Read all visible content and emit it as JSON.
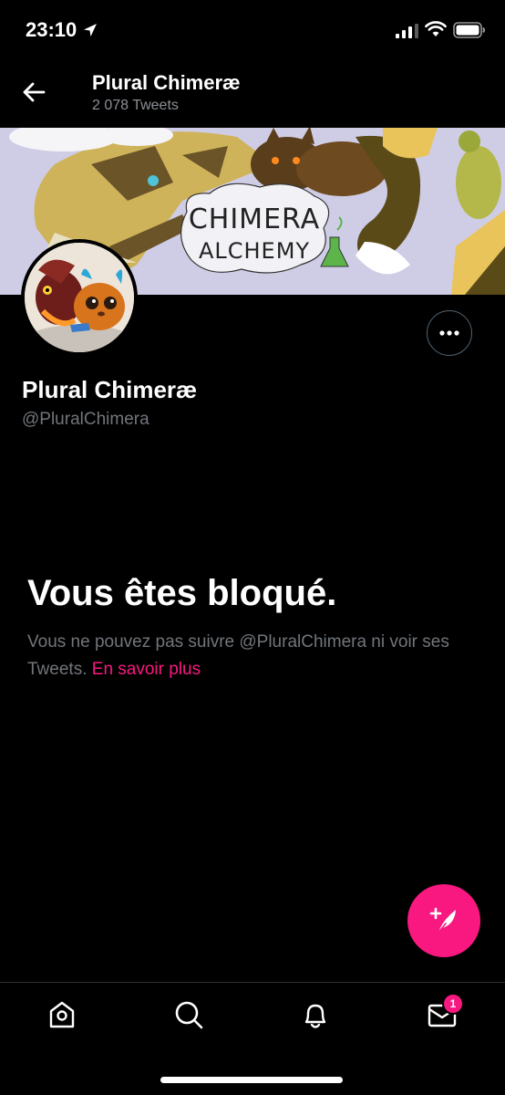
{
  "status_bar": {
    "time": "23:10",
    "icons": [
      "location-arrow-icon",
      "signal-icon",
      "wifi-icon",
      "battery-icon"
    ]
  },
  "header": {
    "back_icon": "arrow-left-icon",
    "title": "Plural Chimeræ",
    "subtitle": "2 078 Tweets"
  },
  "banner": {
    "text_line1": "CHIMERA",
    "text_line2": "ALCHEMY",
    "background_color": "#cfcde6"
  },
  "profile": {
    "name": "Plural Chimeræ",
    "handle": "@PluralChimera",
    "more_icon": "more-horizontal-icon"
  },
  "blocked": {
    "title": "Vous êtes bloqué.",
    "description": "Vous ne pouvez pas suivre @PluralChimera ni voir ses Tweets.",
    "learn_more": "En savoir plus"
  },
  "fab": {
    "icon": "compose-tweet-icon",
    "color": "#f91880"
  },
  "tabs": [
    {
      "name": "home",
      "icon": "home-icon"
    },
    {
      "name": "search",
      "icon": "search-icon"
    },
    {
      "name": "notifications",
      "icon": "bell-icon"
    },
    {
      "name": "messages",
      "icon": "mail-icon",
      "badge": "1"
    }
  ],
  "colors": {
    "accent": "#f91880",
    "background": "#000000",
    "secondary_text": "#71767b"
  }
}
